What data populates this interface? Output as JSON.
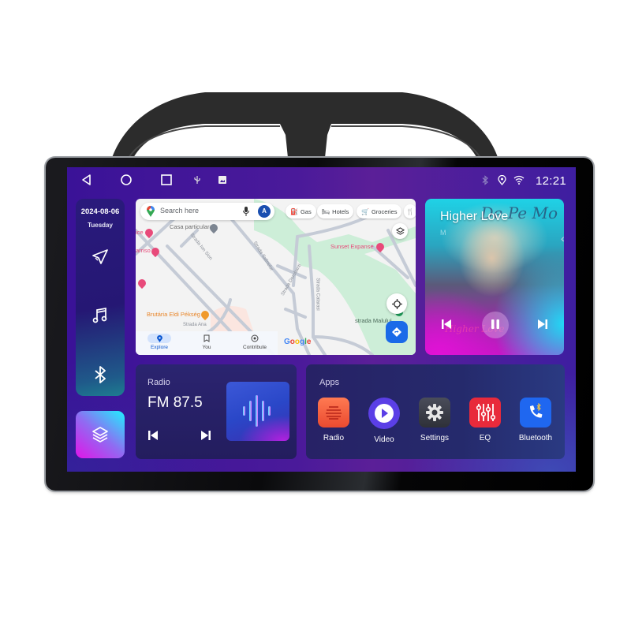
{
  "status_bar": {
    "nav": [
      {
        "name": "back-icon"
      },
      {
        "name": "home-icon"
      },
      {
        "name": "recents-icon"
      }
    ],
    "indicators": [
      "usb-icon",
      "gallery-icon"
    ],
    "right_icons": [
      "bluetooth-icon",
      "location-icon",
      "wifi-icon"
    ],
    "time": "12:21"
  },
  "sidebar": {
    "date": "2024-08-06",
    "day": "Tuesday",
    "items": [
      {
        "name": "navigation-icon"
      },
      {
        "name": "music-icon"
      },
      {
        "name": "bluetooth-icon"
      }
    ],
    "layers_button": {
      "name": "layers-icon"
    }
  },
  "map": {
    "search_placeholder": "Search here",
    "avatar_initial": "A",
    "chips": [
      "Gas",
      "Hotels",
      "Groceries"
    ],
    "labels": {
      "casa": "Casa particulara",
      "sunset": "Sunset Expanse",
      "brutaria": "Brutária Eldi Pékség",
      "strada_malului": "strada Malului",
      "strada_ion": "Strada Ion Sion",
      "strada_salinelor": "Strada Salinelor",
      "strada_dorobanti": "Strada Dorobanti",
      "strada_calarasi": "Strada Calarasi",
      "strada_ana": "Strada Ana",
      "poi_partial_1": "ice",
      "poi_partial_2": "arriso",
      "google": "Google"
    },
    "bottom_nav": [
      {
        "label": "Explore",
        "active": true
      },
      {
        "label": "You",
        "active": false
      },
      {
        "label": "Contribute",
        "active": false
      }
    ]
  },
  "music": {
    "title": "Higher Love",
    "artist_partial": "M",
    "album_text": "De Pe Mo",
    "script_text": "Higher Love"
  },
  "radio": {
    "label": "Radio",
    "frequency": "FM 87.5"
  },
  "apps": {
    "label": "Apps",
    "items": [
      {
        "label": "Radio",
        "color": "#f2563c"
      },
      {
        "label": "Video",
        "color": "#5b3fe6"
      },
      {
        "label": "Settings",
        "color": "#3c3f4a"
      },
      {
        "label": "EQ",
        "color": "#e82a3b"
      },
      {
        "label": "Bluetooth",
        "color": "#1f67f0"
      }
    ]
  }
}
